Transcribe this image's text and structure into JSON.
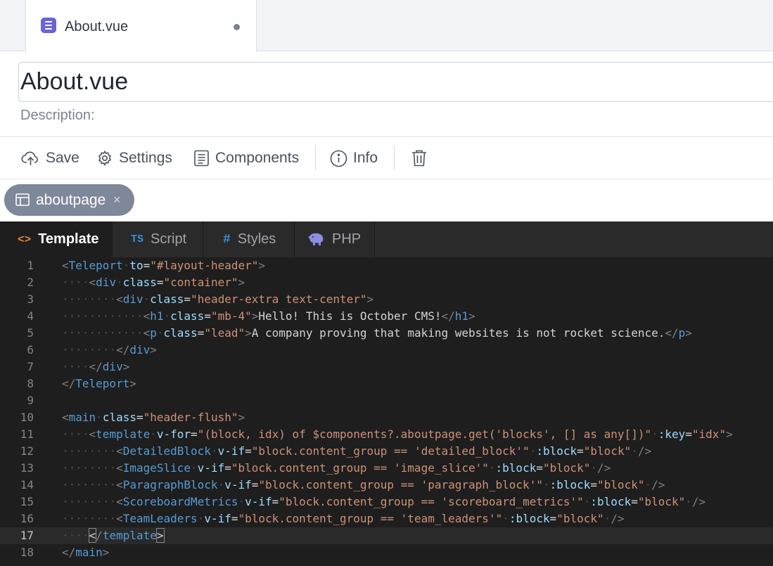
{
  "tabs": [
    {
      "title": "About.vue",
      "icon": "vue-file-icon",
      "modified": true
    }
  ],
  "page": {
    "name": "About.vue",
    "description_label": "Description:"
  },
  "toolbar": {
    "save": "Save",
    "settings": "Settings",
    "components": "Components",
    "info": "Info",
    "delete_icon": "trash-icon"
  },
  "chip": {
    "label": "aboutpage",
    "close": "×"
  },
  "editor": {
    "tabs": [
      {
        "label": "Template",
        "icon": "<>",
        "active": true
      },
      {
        "label": "Script",
        "icon": "TS"
      },
      {
        "label": "Styles",
        "icon": "#"
      },
      {
        "label": "PHP",
        "icon": "php-elephant-icon"
      }
    ],
    "current_line": 17,
    "colors": {
      "tag": "#569cd6",
      "attribute": "#9cdcfe",
      "string": "#ce9178",
      "text": "#d4d4d4",
      "punctuation": "#808080",
      "background": "#1e1e1e"
    },
    "lines": [
      [
        [
          "pu",
          "<"
        ],
        [
          "tg",
          "Teleport"
        ],
        [
          "ws",
          "·"
        ],
        [
          "at",
          "to"
        ],
        [
          "tx",
          "="
        ],
        [
          "st",
          "\"#layout-header\""
        ],
        [
          "pu",
          ">"
        ]
      ],
      [
        [
          "ws",
          "····"
        ],
        [
          "pu",
          "<"
        ],
        [
          "tg",
          "div"
        ],
        [
          "ws",
          "·"
        ],
        [
          "at",
          "class"
        ],
        [
          "tx",
          "="
        ],
        [
          "st",
          "\"container\""
        ],
        [
          "pu",
          ">"
        ]
      ],
      [
        [
          "ws",
          "········"
        ],
        [
          "pu",
          "<"
        ],
        [
          "tg",
          "div"
        ],
        [
          "ws",
          "·"
        ],
        [
          "at",
          "class"
        ],
        [
          "tx",
          "="
        ],
        [
          "st",
          "\"header-extra text-center\""
        ],
        [
          "pu",
          ">"
        ]
      ],
      [
        [
          "ws",
          "············"
        ],
        [
          "pu",
          "<"
        ],
        [
          "tg",
          "h1"
        ],
        [
          "ws",
          "·"
        ],
        [
          "at",
          "class"
        ],
        [
          "tx",
          "="
        ],
        [
          "st",
          "\"mb-4\""
        ],
        [
          "pu",
          ">"
        ],
        [
          "tx",
          "Hello! This is October CMS!"
        ],
        [
          "pu",
          "</"
        ],
        [
          "tg",
          "h1"
        ],
        [
          "pu",
          ">"
        ]
      ],
      [
        [
          "ws",
          "············"
        ],
        [
          "pu",
          "<"
        ],
        [
          "tg",
          "p"
        ],
        [
          "ws",
          "·"
        ],
        [
          "at",
          "class"
        ],
        [
          "tx",
          "="
        ],
        [
          "st",
          "\"lead\""
        ],
        [
          "pu",
          ">"
        ],
        [
          "tx",
          "A company proving that making websites is not rocket science."
        ],
        [
          "pu",
          "</"
        ],
        [
          "tg",
          "p"
        ],
        [
          "pu",
          ">"
        ]
      ],
      [
        [
          "ws",
          "········"
        ],
        [
          "pu",
          "</"
        ],
        [
          "tg",
          "div"
        ],
        [
          "pu",
          ">"
        ]
      ],
      [
        [
          "ws",
          "····"
        ],
        [
          "pu",
          "</"
        ],
        [
          "tg",
          "div"
        ],
        [
          "pu",
          ">"
        ]
      ],
      [
        [
          "pu",
          "</"
        ],
        [
          "tg",
          "Teleport"
        ],
        [
          "pu",
          ">"
        ]
      ],
      [],
      [
        [
          "pu",
          "<"
        ],
        [
          "tg",
          "main"
        ],
        [
          "ws",
          "·"
        ],
        [
          "at",
          "class"
        ],
        [
          "tx",
          "="
        ],
        [
          "st",
          "\"header-flush\""
        ],
        [
          "pu",
          ">"
        ]
      ],
      [
        [
          "ws",
          "····"
        ],
        [
          "pu",
          "<"
        ],
        [
          "tg",
          "template"
        ],
        [
          "ws",
          "·"
        ],
        [
          "at",
          "v-for"
        ],
        [
          "tx",
          "="
        ],
        [
          "st",
          "\"(block, idx) of $components?.aboutpage.get('blocks', [] as any[])\""
        ],
        [
          "ws",
          "·"
        ],
        [
          "at",
          ":key"
        ],
        [
          "tx",
          "="
        ],
        [
          "st",
          "\"idx\""
        ],
        [
          "pu",
          ">"
        ]
      ],
      [
        [
          "ws",
          "········"
        ],
        [
          "pu",
          "<"
        ],
        [
          "tg",
          "DetailedBlock"
        ],
        [
          "ws",
          "·"
        ],
        [
          "at",
          "v-if"
        ],
        [
          "tx",
          "="
        ],
        [
          "st",
          "\"block.content_group == 'detailed_block'\""
        ],
        [
          "ws",
          "·"
        ],
        [
          "at",
          ":block"
        ],
        [
          "tx",
          "="
        ],
        [
          "st",
          "\"block\""
        ],
        [
          "ws",
          "·"
        ],
        [
          "pu",
          "/>"
        ]
      ],
      [
        [
          "ws",
          "········"
        ],
        [
          "pu",
          "<"
        ],
        [
          "tg",
          "ImageSlice"
        ],
        [
          "ws",
          "·"
        ],
        [
          "at",
          "v-if"
        ],
        [
          "tx",
          "="
        ],
        [
          "st",
          "\"block.content_group == 'image_slice'\""
        ],
        [
          "ws",
          "·"
        ],
        [
          "at",
          ":block"
        ],
        [
          "tx",
          "="
        ],
        [
          "st",
          "\"block\""
        ],
        [
          "ws",
          "·"
        ],
        [
          "pu",
          "/>"
        ]
      ],
      [
        [
          "ws",
          "········"
        ],
        [
          "pu",
          "<"
        ],
        [
          "tg",
          "ParagraphBlock"
        ],
        [
          "ws",
          "·"
        ],
        [
          "at",
          "v-if"
        ],
        [
          "tx",
          "="
        ],
        [
          "st",
          "\"block.content_group == 'paragraph_block'\""
        ],
        [
          "ws",
          "·"
        ],
        [
          "at",
          ":block"
        ],
        [
          "tx",
          "="
        ],
        [
          "st",
          "\"block\""
        ],
        [
          "ws",
          "·"
        ],
        [
          "pu",
          "/>"
        ]
      ],
      [
        [
          "ws",
          "········"
        ],
        [
          "pu",
          "<"
        ],
        [
          "tg",
          "ScoreboardMetrics"
        ],
        [
          "ws",
          "·"
        ],
        [
          "at",
          "v-if"
        ],
        [
          "tx",
          "="
        ],
        [
          "st",
          "\"block.content_group == 'scoreboard_metrics'\""
        ],
        [
          "ws",
          "·"
        ],
        [
          "at",
          ":block"
        ],
        [
          "tx",
          "="
        ],
        [
          "st",
          "\"block\""
        ],
        [
          "ws",
          "·"
        ],
        [
          "pu",
          "/>"
        ]
      ],
      [
        [
          "ws",
          "········"
        ],
        [
          "pu",
          "<"
        ],
        [
          "tg",
          "TeamLeaders"
        ],
        [
          "ws",
          "·"
        ],
        [
          "at",
          "v-if"
        ],
        [
          "tx",
          "="
        ],
        [
          "st",
          "\"block.content_group == 'team_leaders'\""
        ],
        [
          "ws",
          "·"
        ],
        [
          "at",
          ":block"
        ],
        [
          "tx",
          "="
        ],
        [
          "st",
          "\"block\""
        ],
        [
          "ws",
          "·"
        ],
        [
          "pu",
          "/>"
        ]
      ],
      [
        [
          "ws",
          "····"
        ],
        [
          "brk",
          "<"
        ],
        [
          "pu",
          "/"
        ],
        [
          "tg",
          "template"
        ],
        [
          "brk",
          ">"
        ]
      ],
      [
        [
          "pu",
          "</"
        ],
        [
          "tg",
          "main"
        ],
        [
          "pu",
          ">"
        ]
      ]
    ]
  }
}
